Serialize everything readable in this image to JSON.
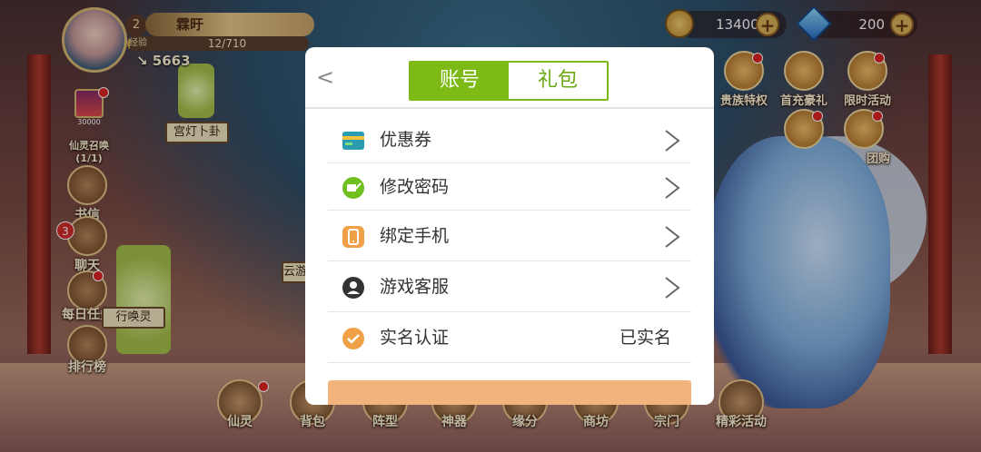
{
  "hud": {
    "level": "2",
    "player_name": "霖旴",
    "exp_label": "经验",
    "exp_text": "12/710",
    "exp_progress": 0.017,
    "power": "5663",
    "copper": "13400",
    "gems": "200",
    "plus": "+"
  },
  "left_menu": {
    "summon_label": "仙灵召唤",
    "summon_count": "(1/1)",
    "summon_token": "30000",
    "mail": "书信",
    "chat": "聊天",
    "chat_badge": "3",
    "daily": "每日任务",
    "rank": "排行榜"
  },
  "scene_signs": {
    "lantern": "宫灯卜卦",
    "cloud": "云游",
    "summon": "行唤灵"
  },
  "top_activities": [
    {
      "label": "贵族特权"
    },
    {
      "label": "首充豪礼"
    },
    {
      "label": "限时活动"
    },
    {
      "label": ""
    },
    {
      "label": "团购"
    }
  ],
  "bottom_nav": [
    {
      "label": "仙灵"
    },
    {
      "label": "背包"
    },
    {
      "label": "阵型"
    },
    {
      "label": "神器"
    },
    {
      "label": "缘分"
    },
    {
      "label": "商坊"
    },
    {
      "label": "宗门"
    },
    {
      "label": "精彩活动"
    }
  ],
  "modal": {
    "back": "<",
    "tabs": [
      {
        "label": "账号",
        "active": true
      },
      {
        "label": "礼包",
        "active": false
      }
    ],
    "rows": [
      {
        "label": "优惠券",
        "icon": "coupon-icon"
      },
      {
        "label": "修改密码",
        "icon": "edit-password-icon"
      },
      {
        "label": "绑定手机",
        "icon": "phone-icon"
      },
      {
        "label": "游戏客服",
        "icon": "customer-service-icon"
      }
    ],
    "realname": {
      "label": "实名认证",
      "status": "已实名",
      "icon": "check-circle-icon"
    },
    "colors": {
      "accent": "#7dba16",
      "orange": "#f0a046",
      "bar": "#f2b47c"
    }
  }
}
